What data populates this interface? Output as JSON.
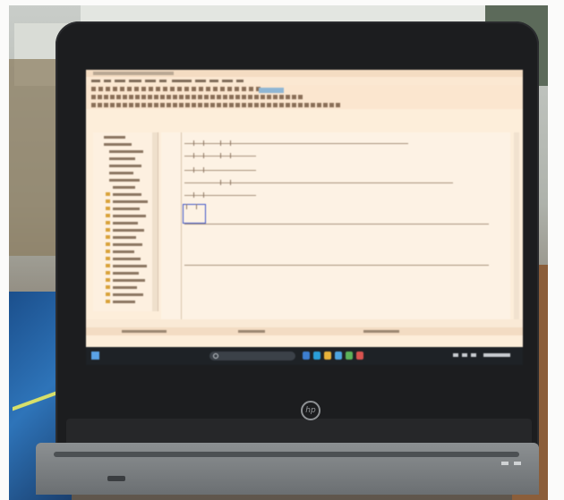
{
  "photo": {
    "subject": "",
    "laptop_logo": "hp"
  },
  "screen": {
    "window_title": "",
    "menu_items": [],
    "tree_items": [],
    "status_text": "",
    "taskbar": {
      "search_placeholder": "",
      "clock": ""
    }
  },
  "colors": {
    "screen_bg": "#fdeeda",
    "selection_box": "#3c53c8",
    "taskbar": "#1e2226",
    "toolbar_highlight": "#8fb6d4"
  },
  "icons": [
    "windows-start-icon",
    "search-icon",
    "taskbar-app-icon",
    "hp-logo-icon",
    "folder-icon"
  ]
}
